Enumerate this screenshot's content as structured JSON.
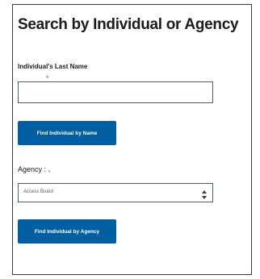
{
  "form": {
    "title": "Search by Individual or Agency",
    "last_name_label": "Individual's Last Name",
    "required_marker": "*",
    "last_name_value": "",
    "find_by_name_button": "Find Individual by Name",
    "agency_label": "Agency",
    "agency_colon": ":",
    "agency_selected": "Access Board",
    "find_by_agency_button": "Find Individual by Agency"
  },
  "colors": {
    "button_bg": "#005ea2",
    "button_text": "#ffffff",
    "required": "#d83933",
    "border": "#565c65"
  },
  "icons": {
    "select_arrows": "chevron-up-down-icon"
  }
}
